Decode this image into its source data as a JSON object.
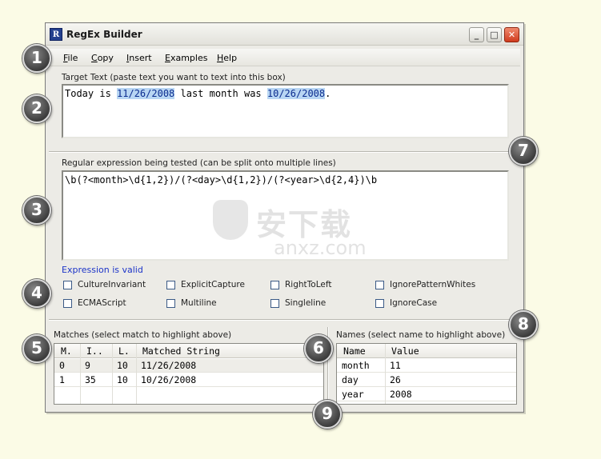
{
  "window": {
    "title": "RegEx Builder",
    "icon_text": "R",
    "controls": {
      "minimize": "_",
      "maximize": "□",
      "close": "✕"
    }
  },
  "menu": [
    {
      "label": "File",
      "ul": "F",
      "rest": "ile"
    },
    {
      "label": "Copy",
      "ul": "C",
      "rest": "opy"
    },
    {
      "label": "Insert",
      "ul": "I",
      "rest": "nsert"
    },
    {
      "label": "Examples",
      "ul": "E",
      "rest": "xamples"
    },
    {
      "label": "Help",
      "ul": "H",
      "rest": "elp"
    }
  ],
  "target": {
    "label": "Target Text (paste text you want to text into this box)",
    "seg1": "Today is ",
    "match1": "11/26/2008",
    "seg2": " last month was ",
    "match2": "10/26/2008",
    "seg3": "."
  },
  "regex": {
    "label": "Regular expression being tested (can be split onto multiple lines)",
    "value": "\\b(?<month>\\d{1,2})/(?<day>\\d{1,2})/(?<year>\\d{2,4})\\b"
  },
  "status": "Expression is valid",
  "options": [
    {
      "label": "CultureInvariant",
      "checked": false
    },
    {
      "label": "ExplicitCapture",
      "checked": false
    },
    {
      "label": "RightToLeft",
      "checked": false
    },
    {
      "label": "IgnorePatternWhites",
      "checked": false
    },
    {
      "label": "ECMAScript",
      "checked": false
    },
    {
      "label": "Multiline",
      "checked": false
    },
    {
      "label": "Singleline",
      "checked": false
    },
    {
      "label": "IgnoreCase",
      "checked": false
    }
  ],
  "matches": {
    "label": "Matches (select match to highlight above)",
    "columns": [
      "M.",
      "I..",
      "L.",
      "Matched String"
    ],
    "rows": [
      [
        "0",
        "9",
        "10",
        "11/26/2008"
      ],
      [
        "1",
        "35",
        "10",
        "10/26/2008"
      ]
    ]
  },
  "names": {
    "label": "Names (select name to highlight above)",
    "columns": [
      "Name",
      "Value"
    ],
    "rows": [
      [
        "month",
        "11"
      ],
      [
        "day",
        "26"
      ],
      [
        "year",
        "2008"
      ]
    ]
  },
  "callouts": [
    "1",
    "2",
    "3",
    "4",
    "5",
    "6",
    "7",
    "8",
    "9"
  ],
  "watermark": {
    "main": "安下载",
    "sub": "anxz.com",
    "shield": "安"
  },
  "colors": {
    "highlight_bg": "#b8d6f3",
    "highlight_fg": "#0b2c8f",
    "valid_text": "#1c34c8",
    "page_bg": "#fbfbe6"
  }
}
